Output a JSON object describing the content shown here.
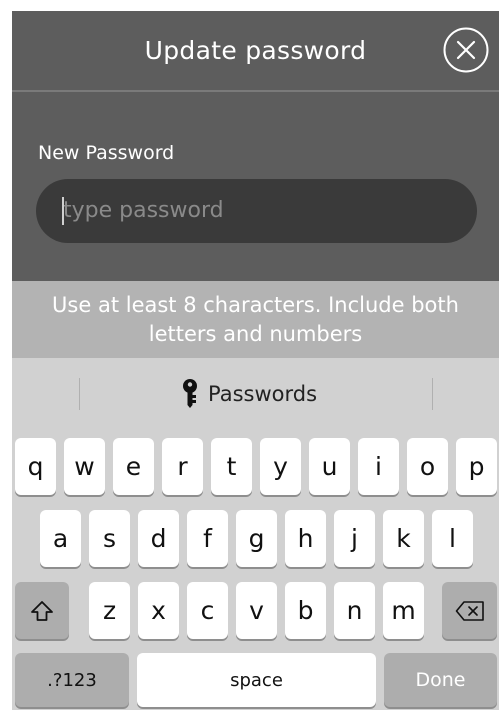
{
  "header": {
    "title": "Update password",
    "close_icon": "close-circle-icon"
  },
  "form": {
    "label": "New Password",
    "placeholder": "type password",
    "value": ""
  },
  "hint": {
    "line1": "Use at least 8 characters. Include both",
    "line2": "letters and numbers"
  },
  "keyboard": {
    "suggestion": {
      "icon": "key-icon",
      "label": "Passwords"
    },
    "rows": [
      [
        "q",
        "w",
        "e",
        "r",
        "t",
        "y",
        "u",
        "i",
        "o",
        "p"
      ],
      [
        "a",
        "s",
        "d",
        "f",
        "g",
        "h",
        "j",
        "k",
        "l"
      ],
      [
        "z",
        "x",
        "c",
        "v",
        "b",
        "n",
        "m"
      ]
    ],
    "shift_icon": "shift-icon",
    "backspace_icon": "backspace-icon",
    "numbers_label": ".?123",
    "space_label": "space",
    "done_label": "Done"
  }
}
